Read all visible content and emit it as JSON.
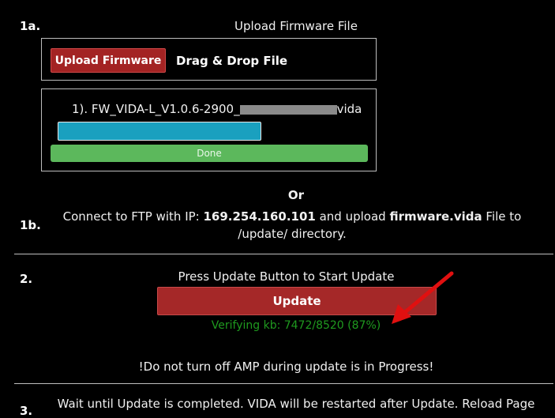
{
  "step1a": {
    "number": "1a.",
    "title": "Upload Firmware File",
    "upload_button": "Upload Firmware",
    "drag_drop": "Drag & Drop File",
    "file_prefix": "1). FW_VIDA-L_V1.0.6-2900_",
    "file_suffix": "vida",
    "upload_progress": 1.0,
    "done_label": "Done"
  },
  "or_label": "Or",
  "step1b": {
    "number": "1b.",
    "text_prefix": "Connect to FTP with IP: ",
    "ip": "169.254.160.101",
    "text_mid": " and upload ",
    "file": "firmware.vida",
    "text_suffix": " File to",
    "text_line2": "/update/ directory."
  },
  "step2": {
    "number": "2.",
    "instruction": "Press Update Button to Start Update",
    "update_button": "Update",
    "verify_status": "Verifying kb: 7472/8520 (87%)",
    "warning": "!Do not turn off AMP during update is in Progress!"
  },
  "step3": {
    "text": "Wait until Update is completed. VIDA will be restarted after Update. Reload Page"
  },
  "colors": {
    "background": "#000000",
    "upload_button": "#a32323",
    "progress": "#1aa0bf",
    "done": "#5cb85c",
    "verify_text": "#1f9a1f",
    "arrow": "#e01010"
  }
}
